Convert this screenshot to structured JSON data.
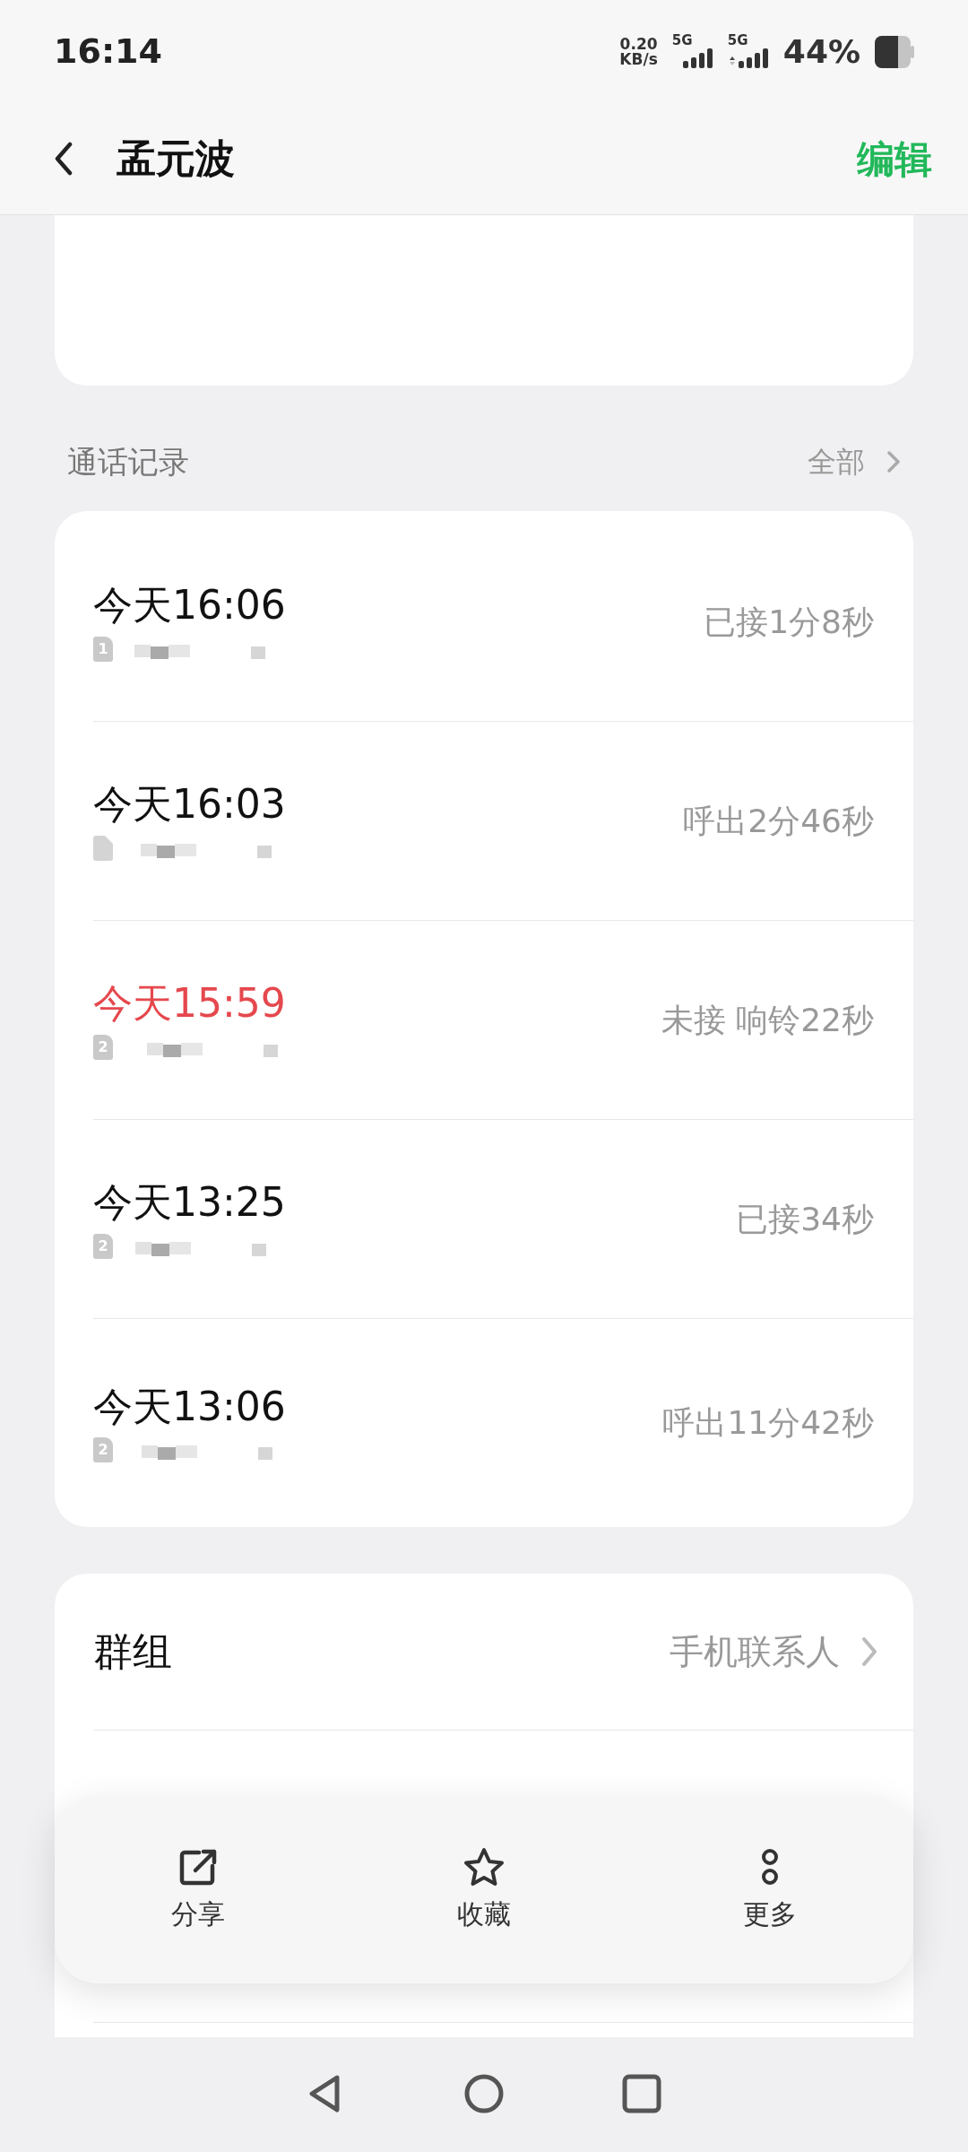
{
  "status_bar": {
    "time": "16:14",
    "net_speed": "0.20",
    "net_unit": "KB/s",
    "sim1_network": "5G",
    "sim2_network": "5G",
    "battery": "44%"
  },
  "header": {
    "title": "孟元波",
    "action": "编辑"
  },
  "call_log": {
    "title": "通话记录",
    "more": "全部",
    "calls": [
      {
        "time": "今天16:06",
        "sim": "1",
        "missed": false,
        "detail": "已接1分8秒"
      },
      {
        "time": "今天16:03",
        "missed": false,
        "detail": "呼出2分46秒"
      },
      {
        "time": "今天15:59",
        "sim": "2",
        "missed": true,
        "detail": "未接 响铃22秒"
      },
      {
        "time": "今天13:25",
        "sim": "2",
        "missed": false,
        "detail": "已接34秒"
      },
      {
        "time": "今天13:06",
        "sim": "2",
        "missed": false,
        "detail": "呼出11分42秒"
      }
    ]
  },
  "settings": [
    {
      "label": "群组",
      "value": "手机联系人"
    }
  ],
  "toolbar": [
    {
      "label": "分享"
    },
    {
      "label": "收藏"
    },
    {
      "label": "更多"
    }
  ]
}
